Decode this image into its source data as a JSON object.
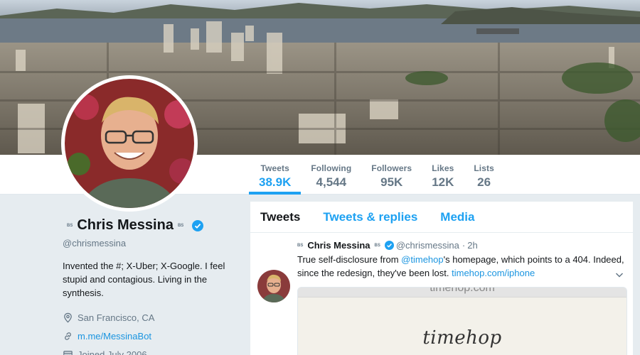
{
  "profile": {
    "name": "Chris Messina",
    "handle": "@chrismessina",
    "bio": "Invented the #; X-Uber; X-Google. I feel stupid and contagious. Living in the synthesis.",
    "location": "San Francisco, CA",
    "link": "m.me/MessinaBot",
    "joined": "Joined July 2006",
    "badge": "BS"
  },
  "stats": [
    {
      "label": "Tweets",
      "value": "38.9K"
    },
    {
      "label": "Following",
      "value": "4,544"
    },
    {
      "label": "Followers",
      "value": "95K"
    },
    {
      "label": "Likes",
      "value": "12K"
    },
    {
      "label": "Lists",
      "value": "26"
    }
  ],
  "tabs": [
    "Tweets",
    "Tweets & replies",
    "Media"
  ],
  "tweet": {
    "name": "Chris Messina",
    "handle": "@chrismessina",
    "dot": "·",
    "time": "2h",
    "badge": "BS",
    "text_before": "True self-disclosure from ",
    "mention": "@timehop",
    "text_after": "'s homepage, which points to a 404. Indeed, since the redesign, they've been lost. ",
    "link": "timehop.com/iphone",
    "card_url": "timehop.com",
    "card_logo": "timehop"
  },
  "colors": {
    "accent": "#1da1f2",
    "link": "#1b95e0",
    "background": "#e6ecf0"
  },
  "icons": [
    "verified-icon",
    "location-icon",
    "link-icon",
    "calendar-icon",
    "chevron-down-icon"
  ]
}
